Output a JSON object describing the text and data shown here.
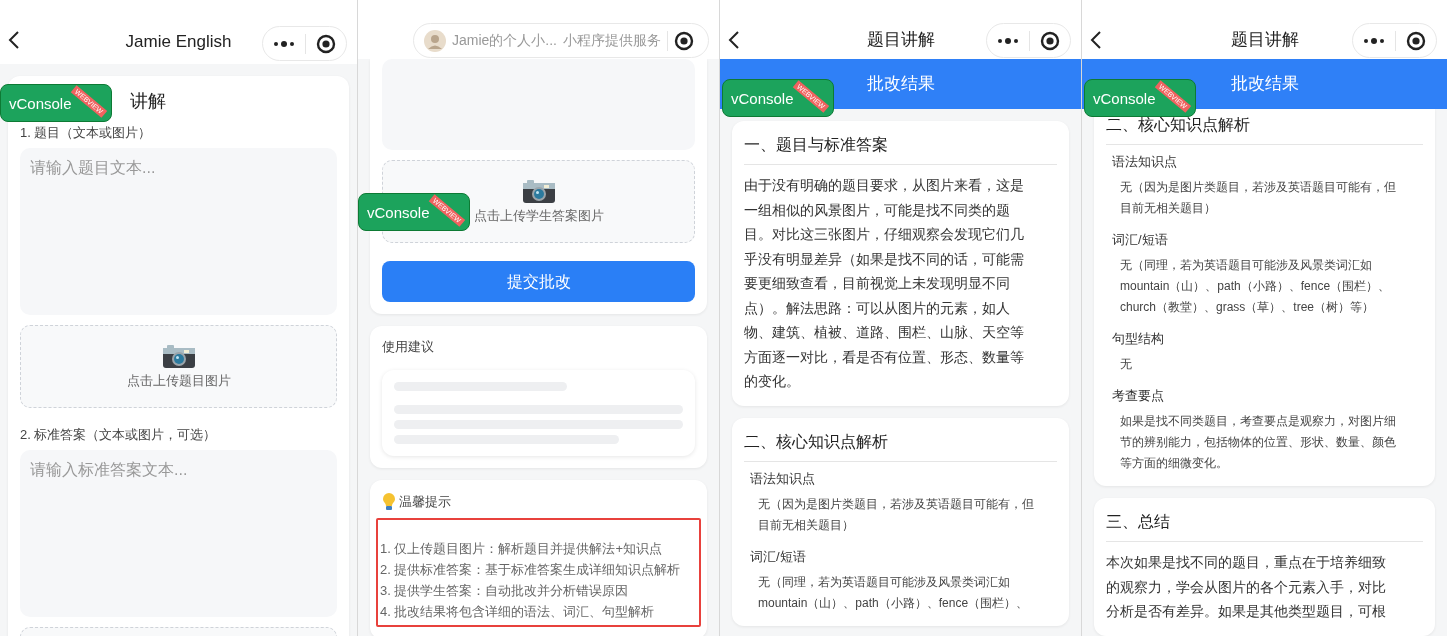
{
  "screens": [
    {
      "nav": {
        "kind": "page",
        "back": true,
        "title": "Jamie English"
      },
      "vconsole": {
        "label": "vConsole",
        "ribbon": "WEBVIEW"
      },
      "cards": [
        {
          "kind": "form",
          "cut_top": false,
          "title": "讲解",
          "items": [
            {
              "kind": "label",
              "text": "1. 题目（文本或图片）"
            },
            {
              "kind": "textarea",
              "placeholder": "请输入题目文本..."
            },
            {
              "kind": "upload",
              "text": "点击上传题目图片"
            },
            {
              "kind": "label",
              "text": "2. 标准答案（文本或图片，可选）"
            },
            {
              "kind": "textarea",
              "placeholder": "请输入标准答案文本..."
            },
            {
              "kind": "upload"
            }
          ]
        }
      ]
    },
    {
      "nav": {
        "kind": "service",
        "service": "Jamie的个人小...",
        "note": "小程序提供服务"
      },
      "vconsole": {
        "label": "vConsole",
        "ribbon": "WEBVIEW"
      },
      "cards": [
        {
          "kind": "form",
          "cut_top": true,
          "items": [
            {
              "kind": "textarea"
            },
            {
              "kind": "upload",
              "text": "点击上传学生答案图片"
            },
            {
              "kind": "button",
              "text": "提交批改"
            }
          ]
        },
        {
          "kind": "form",
          "cut_top": false,
          "title": "使用建议",
          "items": [
            {
              "kind": "skeleton"
            }
          ]
        },
        {
          "kind": "tips",
          "cut_top": false,
          "title": "温馨提示",
          "items": [
            {
              "kind": "tips",
              "lines": [
                "1. 仅上传题目图片：解析题目并提供解法+知识点",
                "2. 提供标准答案：基于标准答案生成详细知识点解析",
                "3. 提供学生答案：自动批改并分析错误原因",
                "4. 批改结果将包含详细的语法、词汇、句型解析"
              ]
            }
          ]
        }
      ]
    },
    {
      "nav": {
        "kind": "page",
        "back": true,
        "title": "题目讲解"
      },
      "banner": "批改结果",
      "vconsole": {
        "label": "vConsole",
        "ribbon": "WEBVIEW"
      },
      "cards": [
        {
          "kind": "section",
          "cut_top": false,
          "title": "一、题目与标准答案",
          "items": [
            {
              "kind": "paragraph",
              "text": "由于没有明确的题目要求，从图片来看，这是一组相似的风景图片，可能是找不同类的题目。对比这三张图片，仔细观察会发现它们几乎没有明显差异（如果是找不同的话，可能需要更细致查看，目前视觉上未发现明显不同点）。解法思路：可以从图片的元素，如人物、建筑、植被、道路、围栏、山脉、天空等方面逐一对比，看是否有位置、形态、数量等的变化。"
            }
          ]
        },
        {
          "kind": "section",
          "cut_top": false,
          "title": "二、核心知识点解析",
          "items": [
            {
              "kind": "subhead",
              "text": "语法知识点"
            },
            {
              "kind": "subtext",
              "text": "无（因为是图片类题目，若涉及英语题目可能有，但目前无相关题目）"
            },
            {
              "kind": "subhead",
              "text": "词汇/短语"
            },
            {
              "kind": "subtext",
              "text": "无（同理，若为英语题目可能涉及风景类词汇如mountain（山）、path（小路）、fence（围栏）、"
            }
          ]
        }
      ]
    },
    {
      "nav": {
        "kind": "page",
        "back": true,
        "title": "题目讲解"
      },
      "banner": "批改结果",
      "vconsole": {
        "label": "vConsole",
        "ribbon": "WEBVIEW"
      },
      "cards": [
        {
          "kind": "section",
          "cut_top": true,
          "title": "二、核心知识点解析",
          "items": [
            {
              "kind": "subhead",
              "text": "语法知识点"
            },
            {
              "kind": "subtext",
              "text": "无（因为是图片类题目，若涉及英语题目可能有，但目前无相关题目）"
            },
            {
              "kind": "subhead",
              "text": "词汇/短语"
            },
            {
              "kind": "subtext",
              "text": "无（同理，若为英语题目可能涉及风景类词汇如mountain（山）、path（小路）、fence（围栏）、church（教堂）、grass（草）、tree（树）等）"
            },
            {
              "kind": "subhead",
              "text": "句型结构"
            },
            {
              "kind": "subtext",
              "text": "无"
            },
            {
              "kind": "subhead",
              "text": "考查要点"
            },
            {
              "kind": "subtext",
              "text": "如果是找不同类题目，考查要点是观察力，对图片细节的辨别能力，包括物体的位置、形状、数量、颜色等方面的细微变化。"
            }
          ]
        },
        {
          "kind": "section",
          "cut_top": false,
          "title": "三、总结",
          "items": [
            {
              "kind": "paragraph",
              "text": "本次如果是找不同的题目，重点在于培养细致的观察力，学会从图片的各个元素入手，对比分析是否有差异。如果是其他类型题目，可根"
            }
          ]
        }
      ]
    }
  ]
}
